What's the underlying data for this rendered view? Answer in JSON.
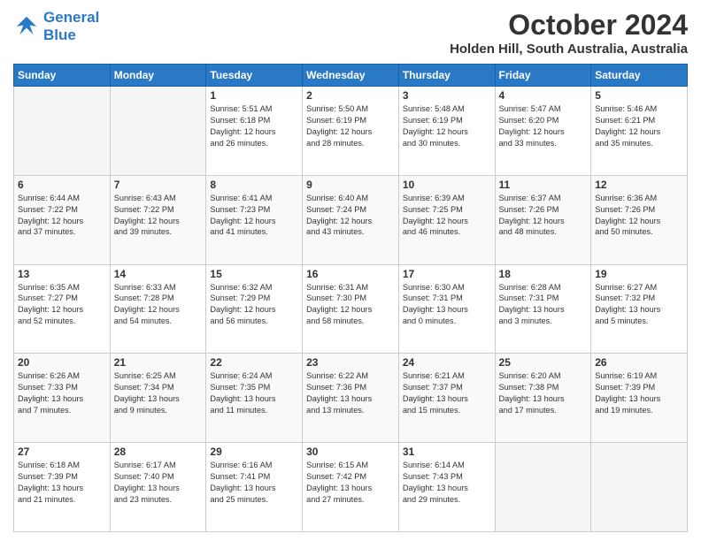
{
  "header": {
    "logo_line1": "General",
    "logo_line2": "Blue",
    "month": "October 2024",
    "location": "Holden Hill, South Australia, Australia"
  },
  "weekdays": [
    "Sunday",
    "Monday",
    "Tuesday",
    "Wednesday",
    "Thursday",
    "Friday",
    "Saturday"
  ],
  "weeks": [
    [
      {
        "day": "",
        "content": ""
      },
      {
        "day": "",
        "content": ""
      },
      {
        "day": "1",
        "content": "Sunrise: 5:51 AM\nSunset: 6:18 PM\nDaylight: 12 hours\nand 26 minutes."
      },
      {
        "day": "2",
        "content": "Sunrise: 5:50 AM\nSunset: 6:19 PM\nDaylight: 12 hours\nand 28 minutes."
      },
      {
        "day": "3",
        "content": "Sunrise: 5:48 AM\nSunset: 6:19 PM\nDaylight: 12 hours\nand 30 minutes."
      },
      {
        "day": "4",
        "content": "Sunrise: 5:47 AM\nSunset: 6:20 PM\nDaylight: 12 hours\nand 33 minutes."
      },
      {
        "day": "5",
        "content": "Sunrise: 5:46 AM\nSunset: 6:21 PM\nDaylight: 12 hours\nand 35 minutes."
      }
    ],
    [
      {
        "day": "6",
        "content": "Sunrise: 6:44 AM\nSunset: 7:22 PM\nDaylight: 12 hours\nand 37 minutes."
      },
      {
        "day": "7",
        "content": "Sunrise: 6:43 AM\nSunset: 7:22 PM\nDaylight: 12 hours\nand 39 minutes."
      },
      {
        "day": "8",
        "content": "Sunrise: 6:41 AM\nSunset: 7:23 PM\nDaylight: 12 hours\nand 41 minutes."
      },
      {
        "day": "9",
        "content": "Sunrise: 6:40 AM\nSunset: 7:24 PM\nDaylight: 12 hours\nand 43 minutes."
      },
      {
        "day": "10",
        "content": "Sunrise: 6:39 AM\nSunset: 7:25 PM\nDaylight: 12 hours\nand 46 minutes."
      },
      {
        "day": "11",
        "content": "Sunrise: 6:37 AM\nSunset: 7:26 PM\nDaylight: 12 hours\nand 48 minutes."
      },
      {
        "day": "12",
        "content": "Sunrise: 6:36 AM\nSunset: 7:26 PM\nDaylight: 12 hours\nand 50 minutes."
      }
    ],
    [
      {
        "day": "13",
        "content": "Sunrise: 6:35 AM\nSunset: 7:27 PM\nDaylight: 12 hours\nand 52 minutes."
      },
      {
        "day": "14",
        "content": "Sunrise: 6:33 AM\nSunset: 7:28 PM\nDaylight: 12 hours\nand 54 minutes."
      },
      {
        "day": "15",
        "content": "Sunrise: 6:32 AM\nSunset: 7:29 PM\nDaylight: 12 hours\nand 56 minutes."
      },
      {
        "day": "16",
        "content": "Sunrise: 6:31 AM\nSunset: 7:30 PM\nDaylight: 12 hours\nand 58 minutes."
      },
      {
        "day": "17",
        "content": "Sunrise: 6:30 AM\nSunset: 7:31 PM\nDaylight: 13 hours\nand 0 minutes."
      },
      {
        "day": "18",
        "content": "Sunrise: 6:28 AM\nSunset: 7:31 PM\nDaylight: 13 hours\nand 3 minutes."
      },
      {
        "day": "19",
        "content": "Sunrise: 6:27 AM\nSunset: 7:32 PM\nDaylight: 13 hours\nand 5 minutes."
      }
    ],
    [
      {
        "day": "20",
        "content": "Sunrise: 6:26 AM\nSunset: 7:33 PM\nDaylight: 13 hours\nand 7 minutes."
      },
      {
        "day": "21",
        "content": "Sunrise: 6:25 AM\nSunset: 7:34 PM\nDaylight: 13 hours\nand 9 minutes."
      },
      {
        "day": "22",
        "content": "Sunrise: 6:24 AM\nSunset: 7:35 PM\nDaylight: 13 hours\nand 11 minutes."
      },
      {
        "day": "23",
        "content": "Sunrise: 6:22 AM\nSunset: 7:36 PM\nDaylight: 13 hours\nand 13 minutes."
      },
      {
        "day": "24",
        "content": "Sunrise: 6:21 AM\nSunset: 7:37 PM\nDaylight: 13 hours\nand 15 minutes."
      },
      {
        "day": "25",
        "content": "Sunrise: 6:20 AM\nSunset: 7:38 PM\nDaylight: 13 hours\nand 17 minutes."
      },
      {
        "day": "26",
        "content": "Sunrise: 6:19 AM\nSunset: 7:39 PM\nDaylight: 13 hours\nand 19 minutes."
      }
    ],
    [
      {
        "day": "27",
        "content": "Sunrise: 6:18 AM\nSunset: 7:39 PM\nDaylight: 13 hours\nand 21 minutes."
      },
      {
        "day": "28",
        "content": "Sunrise: 6:17 AM\nSunset: 7:40 PM\nDaylight: 13 hours\nand 23 minutes."
      },
      {
        "day": "29",
        "content": "Sunrise: 6:16 AM\nSunset: 7:41 PM\nDaylight: 13 hours\nand 25 minutes."
      },
      {
        "day": "30",
        "content": "Sunrise: 6:15 AM\nSunset: 7:42 PM\nDaylight: 13 hours\nand 27 minutes."
      },
      {
        "day": "31",
        "content": "Sunrise: 6:14 AM\nSunset: 7:43 PM\nDaylight: 13 hours\nand 29 minutes."
      },
      {
        "day": "",
        "content": ""
      },
      {
        "day": "",
        "content": ""
      }
    ]
  ]
}
